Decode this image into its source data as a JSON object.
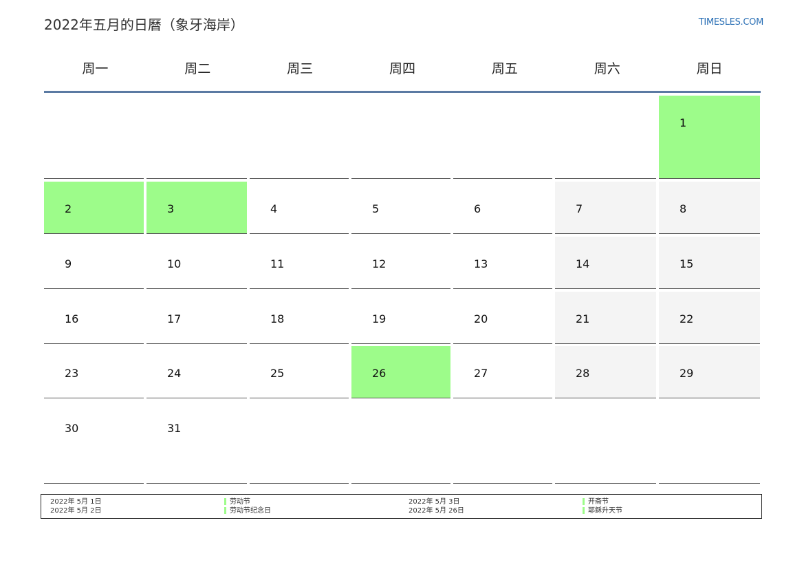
{
  "header": {
    "title": "2022年五月的日曆（象牙海岸）",
    "brand": "TIMESLES.COM"
  },
  "weekdays": [
    "周一",
    "周二",
    "周三",
    "周四",
    "周五",
    "周六",
    "周日"
  ],
  "colors": {
    "holiday": "#9dfc8a",
    "weekend": "#f4f4f4",
    "header_rule": "#5b7aa3",
    "brand": "#2a6fb5"
  },
  "calendar": {
    "weeks": [
      [
        "",
        "",
        "",
        "",
        "",
        "",
        "1"
      ],
      [
        "2",
        "3",
        "4",
        "5",
        "6",
        "7",
        "8"
      ],
      [
        "9",
        "10",
        "11",
        "12",
        "13",
        "14",
        "15"
      ],
      [
        "16",
        "17",
        "18",
        "19",
        "20",
        "21",
        "22"
      ],
      [
        "23",
        "24",
        "25",
        "26",
        "27",
        "28",
        "29"
      ],
      [
        "30",
        "31",
        "",
        "",
        "",
        "",
        ""
      ]
    ],
    "holidays": [
      "1",
      "2",
      "3",
      "26"
    ]
  },
  "legend": [
    {
      "date": "2022年 5月 1日",
      "name": "劳动节"
    },
    {
      "date": "2022年 5月 3日",
      "name": "开斋节"
    },
    {
      "date": "2022年 5月 2日",
      "name": "劳动节纪念日"
    },
    {
      "date": "2022年 5月 26日",
      "name": "耶稣升天节"
    }
  ]
}
